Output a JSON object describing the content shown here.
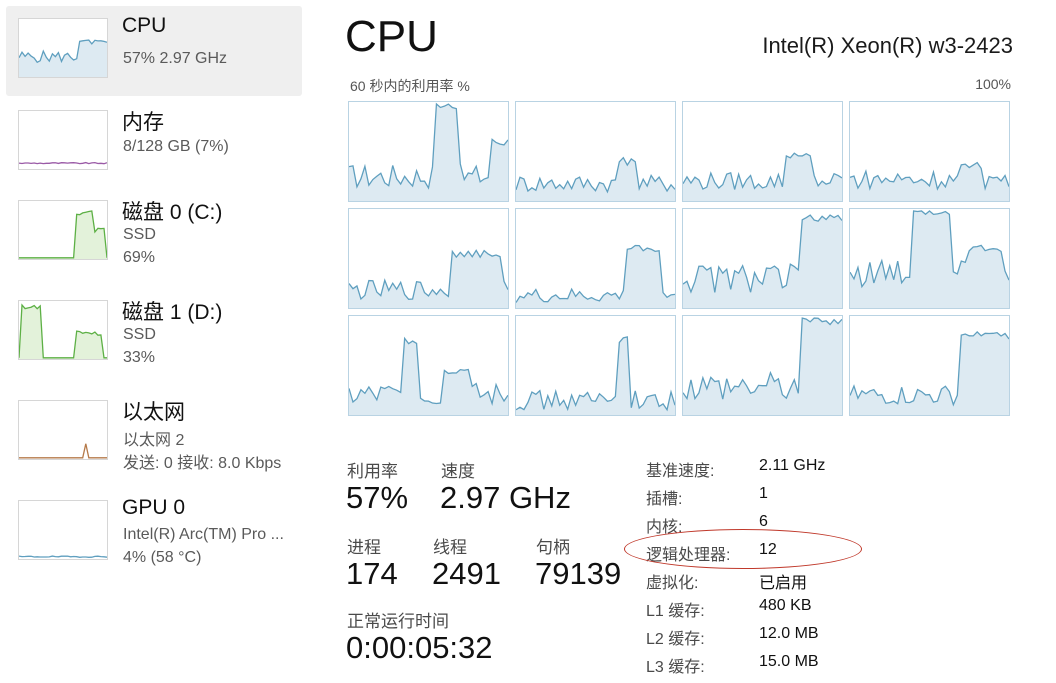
{
  "colors": {
    "cpu_line": "#5f9fbf",
    "cpu_fill": "#ddeaf2",
    "memory_line": "#9a5aa6",
    "disk_line": "#5db045",
    "disk_fill": "#e3f2da",
    "ethernet_line": "#b57a4a",
    "gpu_line": "#5f9fbf",
    "grid_border": "#b9d3e3",
    "annotation": "#c0392b"
  },
  "sidebar": {
    "devices": [
      {
        "id": "cpu",
        "title": "CPU",
        "lines": [
          "57%  2.97 GHz"
        ],
        "selected": true,
        "icon": "cpu-usage-graph"
      },
      {
        "id": "memory",
        "title": "内存",
        "lines": [
          "8/128 GB (7%)"
        ],
        "selected": false,
        "icon": "memory-usage-graph"
      },
      {
        "id": "disk0",
        "title": "磁盘 0 (C:)",
        "lines": [
          "SSD",
          "69%"
        ],
        "selected": false,
        "icon": "disk-usage-graph"
      },
      {
        "id": "disk1",
        "title": "磁盘 1 (D:)",
        "lines": [
          "SSD",
          "33%"
        ],
        "selected": false,
        "icon": "disk-usage-graph"
      },
      {
        "id": "ethernet",
        "title": "以太网",
        "lines": [
          "以太网 2",
          "发送: 0  接收: 8.0 Kbps"
        ],
        "selected": false,
        "icon": "network-usage-graph"
      },
      {
        "id": "gpu0",
        "title": "GPU 0",
        "lines": [
          "Intel(R) Arc(TM) Pro ...",
          "4% (58 °C)"
        ],
        "selected": false,
        "icon": "gpu-usage-graph"
      }
    ]
  },
  "main": {
    "title": "CPU",
    "model": "Intel(R) Xeon(R) w3-2423",
    "graph_caption": "60 秒内的利用率 %",
    "graph_max": "100%",
    "stats": {
      "utilization_label": "利用率",
      "utilization_value": "57%",
      "speed_label": "速度",
      "speed_value": "2.97 GHz",
      "processes_label": "进程",
      "processes_value": "174",
      "threads_label": "线程",
      "threads_value": "2491",
      "handles_label": "句柄",
      "handles_value": "79139",
      "uptime_label": "正常运行时间",
      "uptime_value": "0:00:05:32"
    },
    "specs": [
      {
        "key": "基准速度:",
        "value": "2.11 GHz"
      },
      {
        "key": "插槽:",
        "value": "1"
      },
      {
        "key": "内核:",
        "value": "6"
      },
      {
        "key": "逻辑处理器:",
        "value": "12",
        "highlighted": true
      },
      {
        "key": "虚拟化:",
        "value": "已启用"
      },
      {
        "key": "L1 缓存:",
        "value": "480 KB"
      },
      {
        "key": "L2 缓存:",
        "value": "12.0 MB"
      },
      {
        "key": "L3 缓存:",
        "value": "15.0 MB"
      }
    ]
  }
}
